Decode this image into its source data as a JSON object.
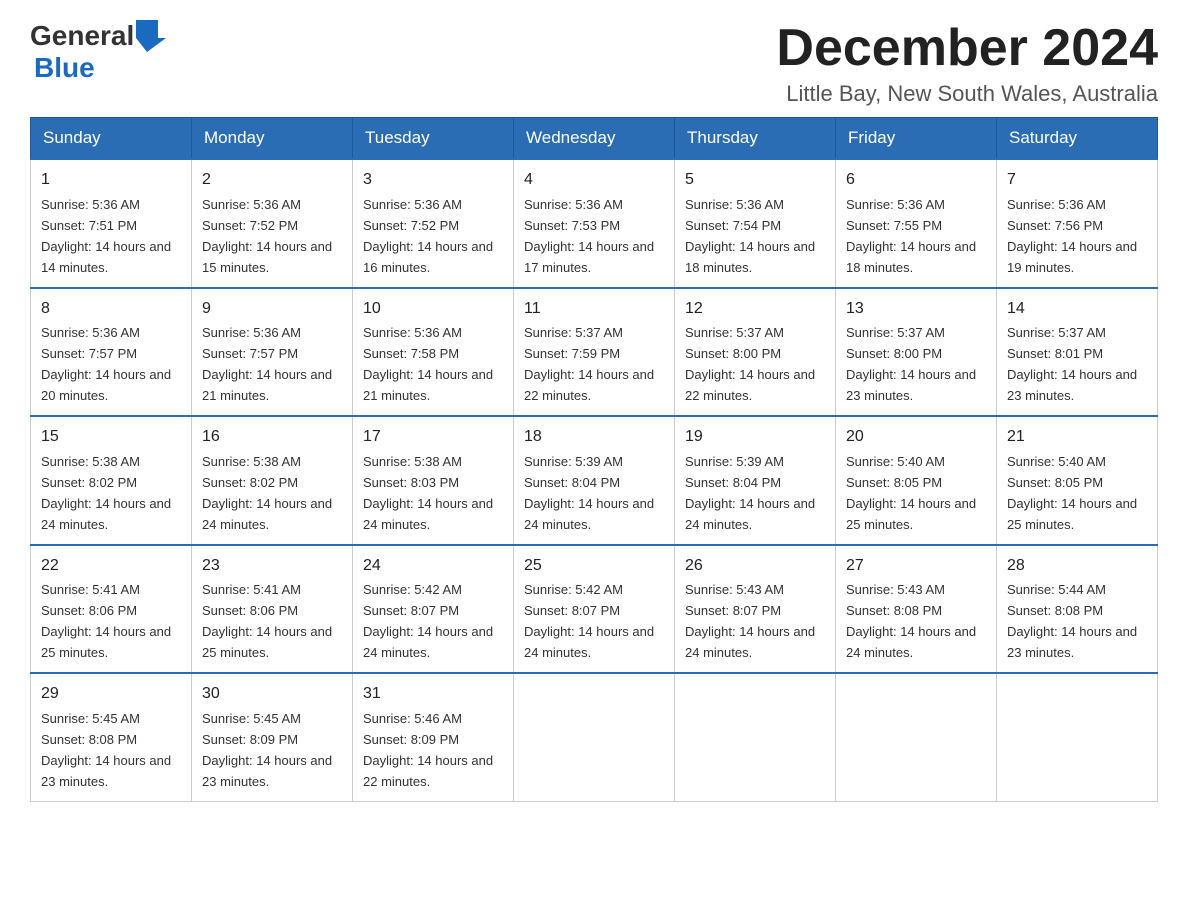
{
  "header": {
    "month_title": "December 2024",
    "location": "Little Bay, New South Wales, Australia",
    "logo_general": "General",
    "logo_blue": "Blue"
  },
  "days_of_week": [
    "Sunday",
    "Monday",
    "Tuesday",
    "Wednesday",
    "Thursday",
    "Friday",
    "Saturday"
  ],
  "weeks": [
    [
      {
        "day": "1",
        "sunrise": "Sunrise: 5:36 AM",
        "sunset": "Sunset: 7:51 PM",
        "daylight": "Daylight: 14 hours and 14 minutes."
      },
      {
        "day": "2",
        "sunrise": "Sunrise: 5:36 AM",
        "sunset": "Sunset: 7:52 PM",
        "daylight": "Daylight: 14 hours and 15 minutes."
      },
      {
        "day": "3",
        "sunrise": "Sunrise: 5:36 AM",
        "sunset": "Sunset: 7:52 PM",
        "daylight": "Daylight: 14 hours and 16 minutes."
      },
      {
        "day": "4",
        "sunrise": "Sunrise: 5:36 AM",
        "sunset": "Sunset: 7:53 PM",
        "daylight": "Daylight: 14 hours and 17 minutes."
      },
      {
        "day": "5",
        "sunrise": "Sunrise: 5:36 AM",
        "sunset": "Sunset: 7:54 PM",
        "daylight": "Daylight: 14 hours and 18 minutes."
      },
      {
        "day": "6",
        "sunrise": "Sunrise: 5:36 AM",
        "sunset": "Sunset: 7:55 PM",
        "daylight": "Daylight: 14 hours and 18 minutes."
      },
      {
        "day": "7",
        "sunrise": "Sunrise: 5:36 AM",
        "sunset": "Sunset: 7:56 PM",
        "daylight": "Daylight: 14 hours and 19 minutes."
      }
    ],
    [
      {
        "day": "8",
        "sunrise": "Sunrise: 5:36 AM",
        "sunset": "Sunset: 7:57 PM",
        "daylight": "Daylight: 14 hours and 20 minutes."
      },
      {
        "day": "9",
        "sunrise": "Sunrise: 5:36 AM",
        "sunset": "Sunset: 7:57 PM",
        "daylight": "Daylight: 14 hours and 21 minutes."
      },
      {
        "day": "10",
        "sunrise": "Sunrise: 5:36 AM",
        "sunset": "Sunset: 7:58 PM",
        "daylight": "Daylight: 14 hours and 21 minutes."
      },
      {
        "day": "11",
        "sunrise": "Sunrise: 5:37 AM",
        "sunset": "Sunset: 7:59 PM",
        "daylight": "Daylight: 14 hours and 22 minutes."
      },
      {
        "day": "12",
        "sunrise": "Sunrise: 5:37 AM",
        "sunset": "Sunset: 8:00 PM",
        "daylight": "Daylight: 14 hours and 22 minutes."
      },
      {
        "day": "13",
        "sunrise": "Sunrise: 5:37 AM",
        "sunset": "Sunset: 8:00 PM",
        "daylight": "Daylight: 14 hours and 23 minutes."
      },
      {
        "day": "14",
        "sunrise": "Sunrise: 5:37 AM",
        "sunset": "Sunset: 8:01 PM",
        "daylight": "Daylight: 14 hours and 23 minutes."
      }
    ],
    [
      {
        "day": "15",
        "sunrise": "Sunrise: 5:38 AM",
        "sunset": "Sunset: 8:02 PM",
        "daylight": "Daylight: 14 hours and 24 minutes."
      },
      {
        "day": "16",
        "sunrise": "Sunrise: 5:38 AM",
        "sunset": "Sunset: 8:02 PM",
        "daylight": "Daylight: 14 hours and 24 minutes."
      },
      {
        "day": "17",
        "sunrise": "Sunrise: 5:38 AM",
        "sunset": "Sunset: 8:03 PM",
        "daylight": "Daylight: 14 hours and 24 minutes."
      },
      {
        "day": "18",
        "sunrise": "Sunrise: 5:39 AM",
        "sunset": "Sunset: 8:04 PM",
        "daylight": "Daylight: 14 hours and 24 minutes."
      },
      {
        "day": "19",
        "sunrise": "Sunrise: 5:39 AM",
        "sunset": "Sunset: 8:04 PM",
        "daylight": "Daylight: 14 hours and 24 minutes."
      },
      {
        "day": "20",
        "sunrise": "Sunrise: 5:40 AM",
        "sunset": "Sunset: 8:05 PM",
        "daylight": "Daylight: 14 hours and 25 minutes."
      },
      {
        "day": "21",
        "sunrise": "Sunrise: 5:40 AM",
        "sunset": "Sunset: 8:05 PM",
        "daylight": "Daylight: 14 hours and 25 minutes."
      }
    ],
    [
      {
        "day": "22",
        "sunrise": "Sunrise: 5:41 AM",
        "sunset": "Sunset: 8:06 PM",
        "daylight": "Daylight: 14 hours and 25 minutes."
      },
      {
        "day": "23",
        "sunrise": "Sunrise: 5:41 AM",
        "sunset": "Sunset: 8:06 PM",
        "daylight": "Daylight: 14 hours and 25 minutes."
      },
      {
        "day": "24",
        "sunrise": "Sunrise: 5:42 AM",
        "sunset": "Sunset: 8:07 PM",
        "daylight": "Daylight: 14 hours and 24 minutes."
      },
      {
        "day": "25",
        "sunrise": "Sunrise: 5:42 AM",
        "sunset": "Sunset: 8:07 PM",
        "daylight": "Daylight: 14 hours and 24 minutes."
      },
      {
        "day": "26",
        "sunrise": "Sunrise: 5:43 AM",
        "sunset": "Sunset: 8:07 PM",
        "daylight": "Daylight: 14 hours and 24 minutes."
      },
      {
        "day": "27",
        "sunrise": "Sunrise: 5:43 AM",
        "sunset": "Sunset: 8:08 PM",
        "daylight": "Daylight: 14 hours and 24 minutes."
      },
      {
        "day": "28",
        "sunrise": "Sunrise: 5:44 AM",
        "sunset": "Sunset: 8:08 PM",
        "daylight": "Daylight: 14 hours and 23 minutes."
      }
    ],
    [
      {
        "day": "29",
        "sunrise": "Sunrise: 5:45 AM",
        "sunset": "Sunset: 8:08 PM",
        "daylight": "Daylight: 14 hours and 23 minutes."
      },
      {
        "day": "30",
        "sunrise": "Sunrise: 5:45 AM",
        "sunset": "Sunset: 8:09 PM",
        "daylight": "Daylight: 14 hours and 23 minutes."
      },
      {
        "day": "31",
        "sunrise": "Sunrise: 5:46 AM",
        "sunset": "Sunset: 8:09 PM",
        "daylight": "Daylight: 14 hours and 22 minutes."
      },
      null,
      null,
      null,
      null
    ]
  ]
}
